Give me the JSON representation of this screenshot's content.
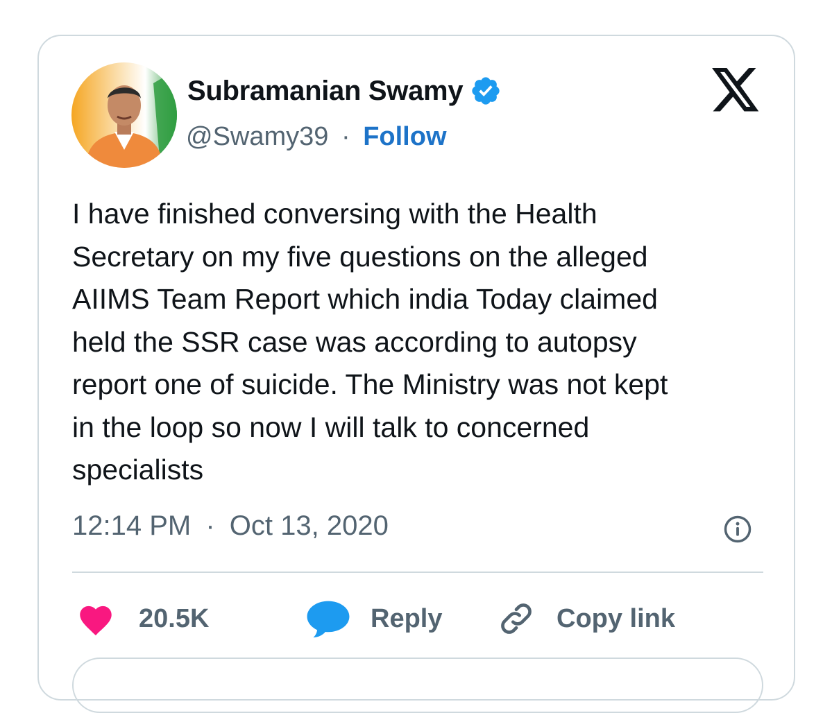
{
  "user": {
    "name": "Subramanian Swamy",
    "handle": "@Swamy39",
    "separator": "·",
    "follow_label": "Follow",
    "verified_icon": "verified-badge-icon",
    "verified_color": "#1d9bf0"
  },
  "platform": {
    "logo_icon": "x-logo-icon"
  },
  "tweet": {
    "text": "I have finished conversing with the Health\nSecretary on my five questions on the alleged\nAIIMS Team Report which india Today claimed\nheld the SSR case was according to autopsy\nreport one of suicide. The Ministry was not kept\nin the loop so now I will talk to concerned\nspecialists",
    "time": "12:14 PM",
    "separator": "·",
    "date": "Oct 13, 2020"
  },
  "actions": {
    "likes_count": "20.5K",
    "reply_label": "Reply",
    "copy_link_label": "Copy link"
  },
  "colors": {
    "like": "#f91880",
    "reply": "#1d9bf0",
    "follow": "#1d73c8",
    "text": "#0f1419",
    "muted": "#536471",
    "border": "#cfd9de"
  }
}
